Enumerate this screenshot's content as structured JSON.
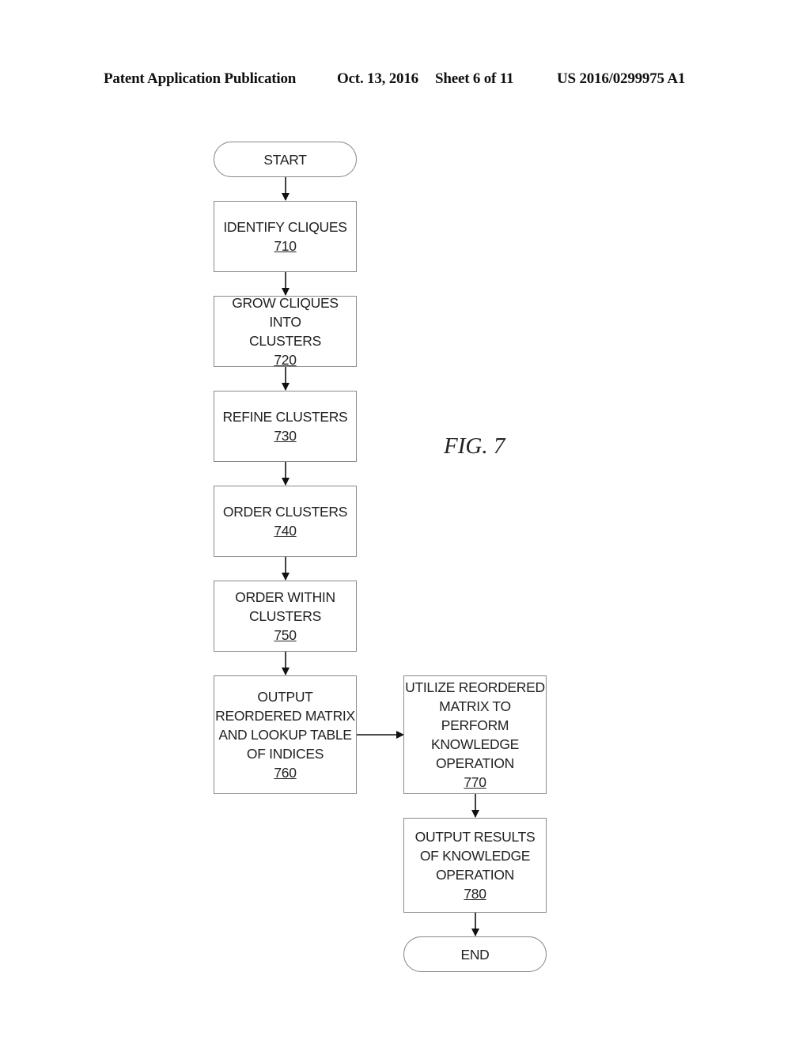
{
  "header": {
    "publication": "Patent Application Publication",
    "date": "Oct. 13, 2016",
    "sheet": "Sheet 6 of 11",
    "number": "US 2016/0299975 A1"
  },
  "figure_label": "FIG. 7",
  "nodes": {
    "start": {
      "text": "START"
    },
    "n710": {
      "lines": [
        "IDENTIFY CLIQUES"
      ],
      "ref": "710"
    },
    "n720": {
      "lines": [
        "GROW CLIQUES INTO",
        "CLUSTERS"
      ],
      "ref": "720"
    },
    "n730": {
      "lines": [
        "REFINE CLUSTERS"
      ],
      "ref": "730"
    },
    "n740": {
      "lines": [
        "ORDER CLUSTERS"
      ],
      "ref": "740"
    },
    "n750": {
      "lines": [
        "ORDER WITHIN",
        "CLUSTERS"
      ],
      "ref": "750"
    },
    "n760": {
      "lines": [
        "OUTPUT",
        "REORDERED MATRIX",
        "AND LOOKUP TABLE",
        "OF INDICES"
      ],
      "ref": "760"
    },
    "n770": {
      "lines": [
        "UTILIZE REORDERED",
        "MATRIX TO",
        "PERFORM",
        "KNOWLEDGE",
        "OPERATION"
      ],
      "ref": "770"
    },
    "n780": {
      "lines": [
        "OUTPUT RESULTS",
        "OF KNOWLEDGE",
        "OPERATION"
      ],
      "ref": "780"
    },
    "end": {
      "text": "END"
    }
  },
  "edges": [
    [
      "start",
      "n710"
    ],
    [
      "n710",
      "n720"
    ],
    [
      "n720",
      "n730"
    ],
    [
      "n730",
      "n740"
    ],
    [
      "n740",
      "n750"
    ],
    [
      "n750",
      "n760"
    ],
    [
      "n760",
      "n770"
    ],
    [
      "n770",
      "n780"
    ],
    [
      "n780",
      "end"
    ]
  ]
}
